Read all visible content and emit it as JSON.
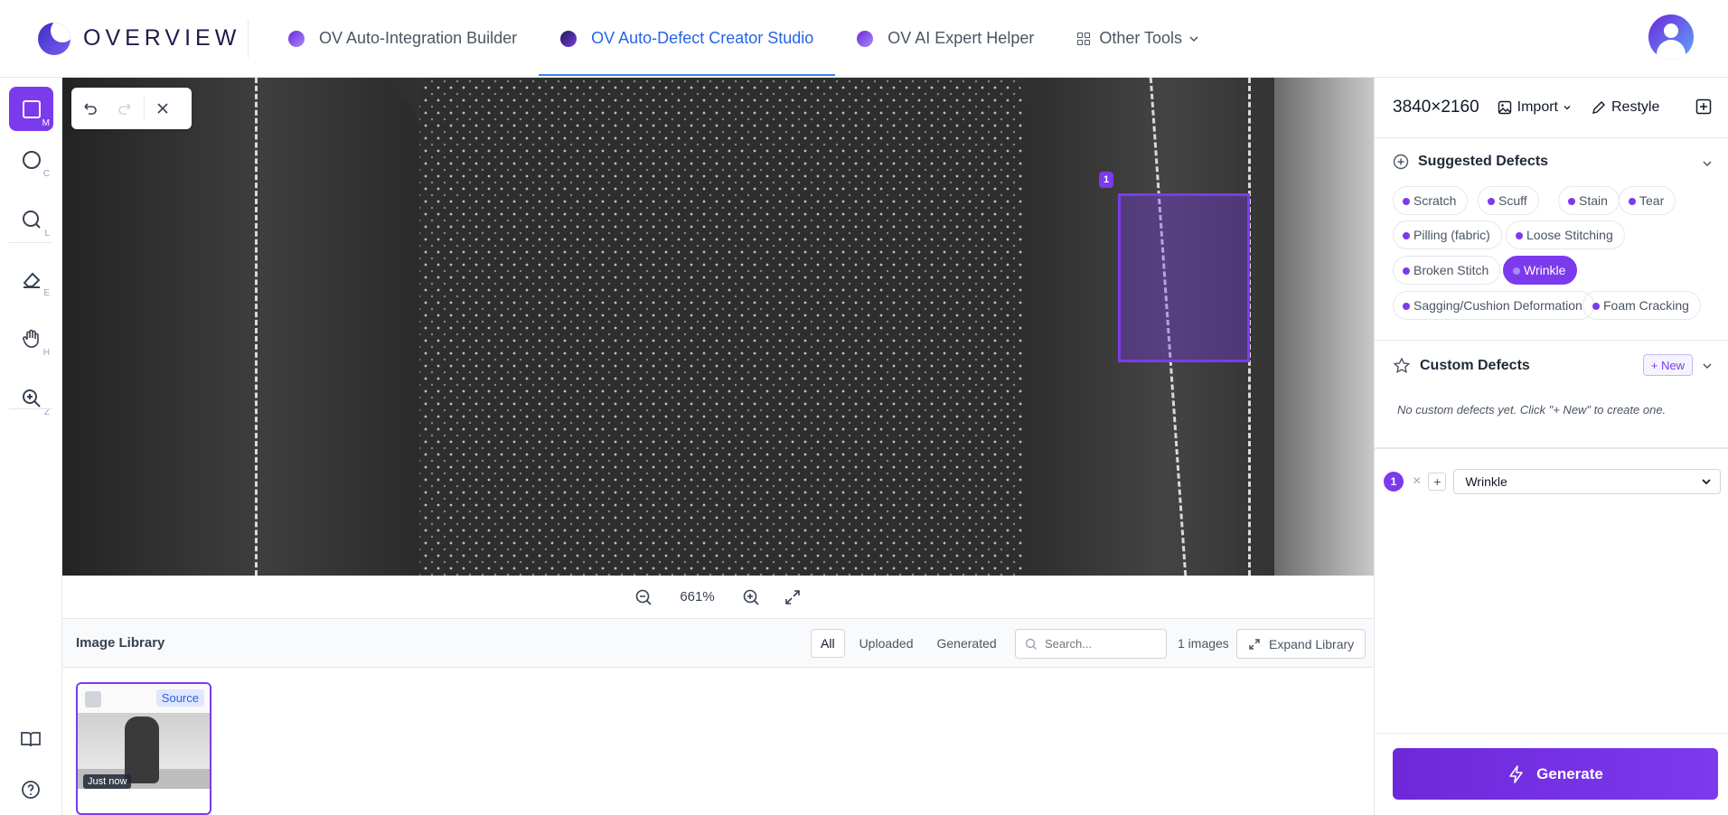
{
  "app": {
    "logo_text": "OVERVIEW"
  },
  "nav": {
    "items": [
      {
        "label": "OV Auto-Integration Builder"
      },
      {
        "label": "OV Auto-Defect Creator Studio"
      },
      {
        "label": "OV AI Expert Helper"
      },
      {
        "label": "Other Tools"
      }
    ]
  },
  "tools": {
    "keys": [
      "M",
      "C",
      "L",
      "E",
      "H",
      "Z"
    ]
  },
  "canvas": {
    "annotation_number": "1"
  },
  "zoom": {
    "value": "661%"
  },
  "library": {
    "title": "Image Library",
    "filters": [
      "All",
      "Uploaded",
      "Generated"
    ],
    "search_placeholder": "Search...",
    "count": "1 images",
    "expand_label": "Expand Library",
    "thumb": {
      "badge": "Source",
      "time": "Just now"
    }
  },
  "panel": {
    "resolution": "3840×2160",
    "import_label": "Import",
    "restyle_label": "Restyle",
    "suggested_title": "Suggested Defects",
    "suggested": [
      "Scratch",
      "Scuff",
      "Stain",
      "Tear",
      "Pilling (fabric)",
      "Loose Stitching",
      "Broken Stitch",
      "Wrinkle",
      "Sagging/Cushion Deformation",
      "Foam Cracking"
    ],
    "selected_defect": "Wrinkle",
    "custom_title": "Custom Defects",
    "custom_new_label": "+ New",
    "custom_empty": "No custom defects yet. Click \"+ New\" to create one.",
    "defect_row": {
      "number": "1",
      "value": "Wrinkle"
    },
    "generate_label": "Generate"
  },
  "colors": {
    "accent": "#7c3aed",
    "link": "#2563eb"
  }
}
